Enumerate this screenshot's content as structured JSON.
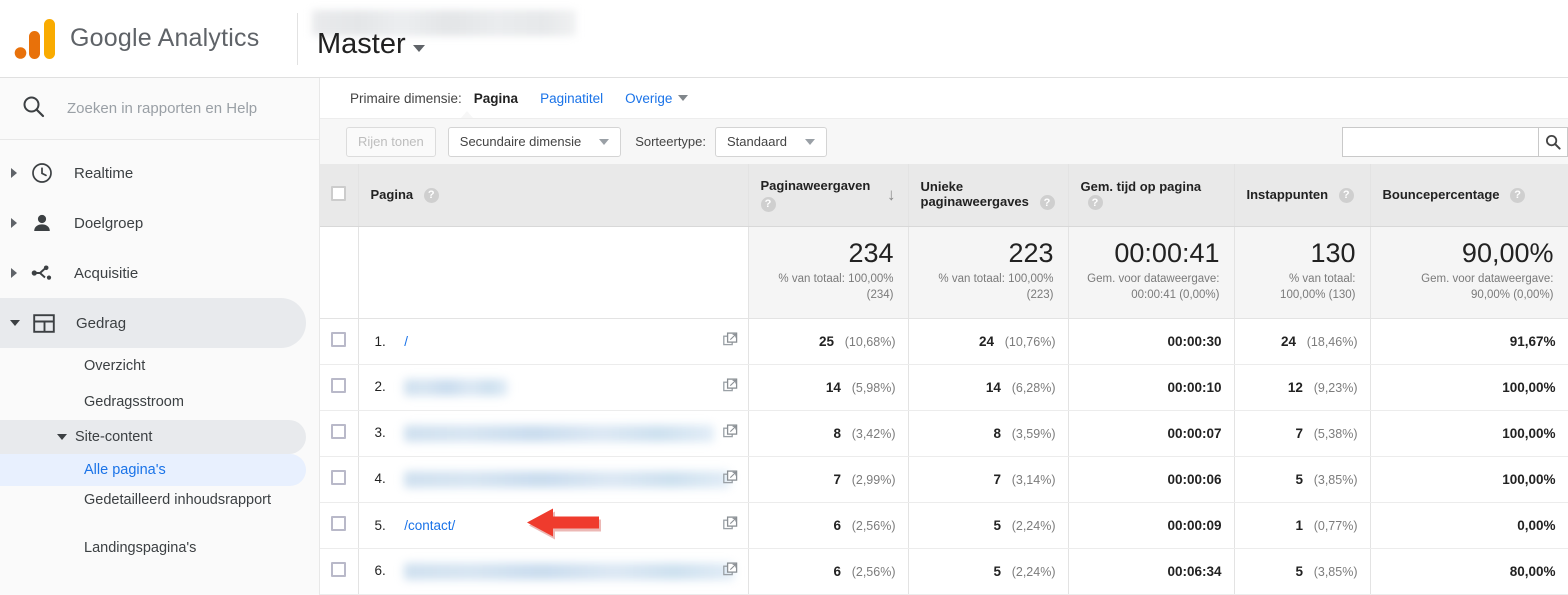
{
  "brand": {
    "name": "Google Analytics",
    "logo_icon": "google-analytics-logo"
  },
  "header": {
    "account_redacted": "",
    "view_name": "Master",
    "caret_icon": "chevron-down-icon"
  },
  "sidebar": {
    "search": {
      "placeholder": "Zoeken in rapporten en Help",
      "value": "",
      "icon": "search-icon"
    },
    "items": [
      {
        "label": "Realtime",
        "icon": "clock-icon"
      },
      {
        "label": "Doelgroep",
        "icon": "person-icon"
      },
      {
        "label": "Acquisitie",
        "icon": "share-nodes-icon"
      },
      {
        "label": "Gedrag",
        "icon": "behavior-panel-icon"
      }
    ],
    "sub_items": [
      {
        "label": "Overzicht"
      },
      {
        "label": "Gedragsstroom"
      },
      {
        "label": "Site-content"
      },
      {
        "label": "Alle pagina's"
      },
      {
        "label": "Gedetailleerd inhoudsrapport"
      },
      {
        "label": "Landingspagina's"
      }
    ]
  },
  "dimension_bar": {
    "label": "Primaire dimensie:",
    "tabs": [
      {
        "label": "Pagina",
        "selected": true
      },
      {
        "label": "Paginatitel",
        "selected": false
      },
      {
        "label": "Overige",
        "selected": false,
        "dropdown": true
      }
    ]
  },
  "toolbar": {
    "show_rows_label": "Rijen tonen",
    "secondary_dimension_label": "Secundaire dimensie",
    "sort_type_label": "Sorteertype:",
    "sort_type_value": "Standaard",
    "search": {
      "value": "",
      "placeholder": "",
      "icon": "search-icon"
    }
  },
  "table": {
    "columns": [
      {
        "label": "Pagina",
        "help": "?"
      },
      {
        "label": "Paginaweergaven",
        "help": "?",
        "sorted": "desc",
        "sort_icon": "arrow-down-icon"
      },
      {
        "label": "Unieke paginaweergaves",
        "help": "?"
      },
      {
        "label": "Gem. tijd op pagina",
        "help": "?"
      },
      {
        "label": "Instappunten",
        "help": "?"
      },
      {
        "label": "Bouncepercentage",
        "help": "?"
      }
    ],
    "totals": [
      {
        "big": "234",
        "sub": "% van totaal: 100,00% (234)"
      },
      {
        "big": "223",
        "sub": "% van totaal: 100,00% (223)"
      },
      {
        "big": "00:00:41",
        "sub": "Gem. voor dataweergave: 00:00:41 (0,00%)"
      },
      {
        "big": "130",
        "sub": "% van totaal: 100,00% (130)"
      },
      {
        "big": "90,00%",
        "sub": "Gem. voor dataweergave: 90,00% (0,00%)"
      }
    ],
    "rows": [
      {
        "rank": "1.",
        "page": "/",
        "redacted": false,
        "redact_w": 0,
        "pageviews": "25",
        "pageviews_pct": "(10,68%)",
        "unique": "24",
        "unique_pct": "(10,76%)",
        "avg_time": "00:00:30",
        "entrances": "24",
        "entrances_pct": "(18,46%)",
        "bounce": "91,67%",
        "annotated": false
      },
      {
        "rank": "2.",
        "page": "",
        "redacted": true,
        "redact_w": 104,
        "pageviews": "14",
        "pageviews_pct": "(5,98%)",
        "unique": "14",
        "unique_pct": "(6,28%)",
        "avg_time": "00:00:10",
        "entrances": "12",
        "entrances_pct": "(9,23%)",
        "bounce": "100,00%",
        "annotated": false
      },
      {
        "rank": "3.",
        "page": "",
        "redacted": true,
        "redact_w": 310,
        "pageviews": "8",
        "pageviews_pct": "(3,42%)",
        "unique": "8",
        "unique_pct": "(3,59%)",
        "avg_time": "00:00:07",
        "entrances": "7",
        "entrances_pct": "(5,38%)",
        "bounce": "100,00%",
        "annotated": false
      },
      {
        "rank": "4.",
        "page": "",
        "redacted": true,
        "redact_w": 326,
        "pageviews": "7",
        "pageviews_pct": "(2,99%)",
        "unique": "7",
        "unique_pct": "(3,14%)",
        "avg_time": "00:00:06",
        "entrances": "5",
        "entrances_pct": "(3,85%)",
        "bounce": "100,00%",
        "annotated": false
      },
      {
        "rank": "5.",
        "page": "/contact/",
        "redacted": false,
        "redact_w": 0,
        "pageviews": "6",
        "pageviews_pct": "(2,56%)",
        "unique": "5",
        "unique_pct": "(2,24%)",
        "avg_time": "00:00:09",
        "entrances": "1",
        "entrances_pct": "(0,77%)",
        "bounce": "0,00%",
        "annotated": true
      },
      {
        "rank": "6.",
        "page": "",
        "redacted": true,
        "redact_w": 330,
        "pageviews": "6",
        "pageviews_pct": "(2,56%)",
        "unique": "5",
        "unique_pct": "(2,24%)",
        "avg_time": "00:06:34",
        "entrances": "5",
        "entrances_pct": "(3,85%)",
        "bounce": "80,00%",
        "annotated": false
      }
    ],
    "row_icon": "open-in-new-window-icon"
  },
  "annotation": {
    "shape": "red-left-arrow",
    "color": "#ef3b2d"
  },
  "colors": {
    "link_blue": "#1a73e8",
    "selected_nav_bg": "#e8f0fe",
    "active_nav_bg": "#e8eaed",
    "header_bg": "#e9e9e9",
    "totals_bg": "#f5f5f5",
    "logo_orange": "#f9ab00",
    "logo_orange_dark": "#e8710a"
  }
}
